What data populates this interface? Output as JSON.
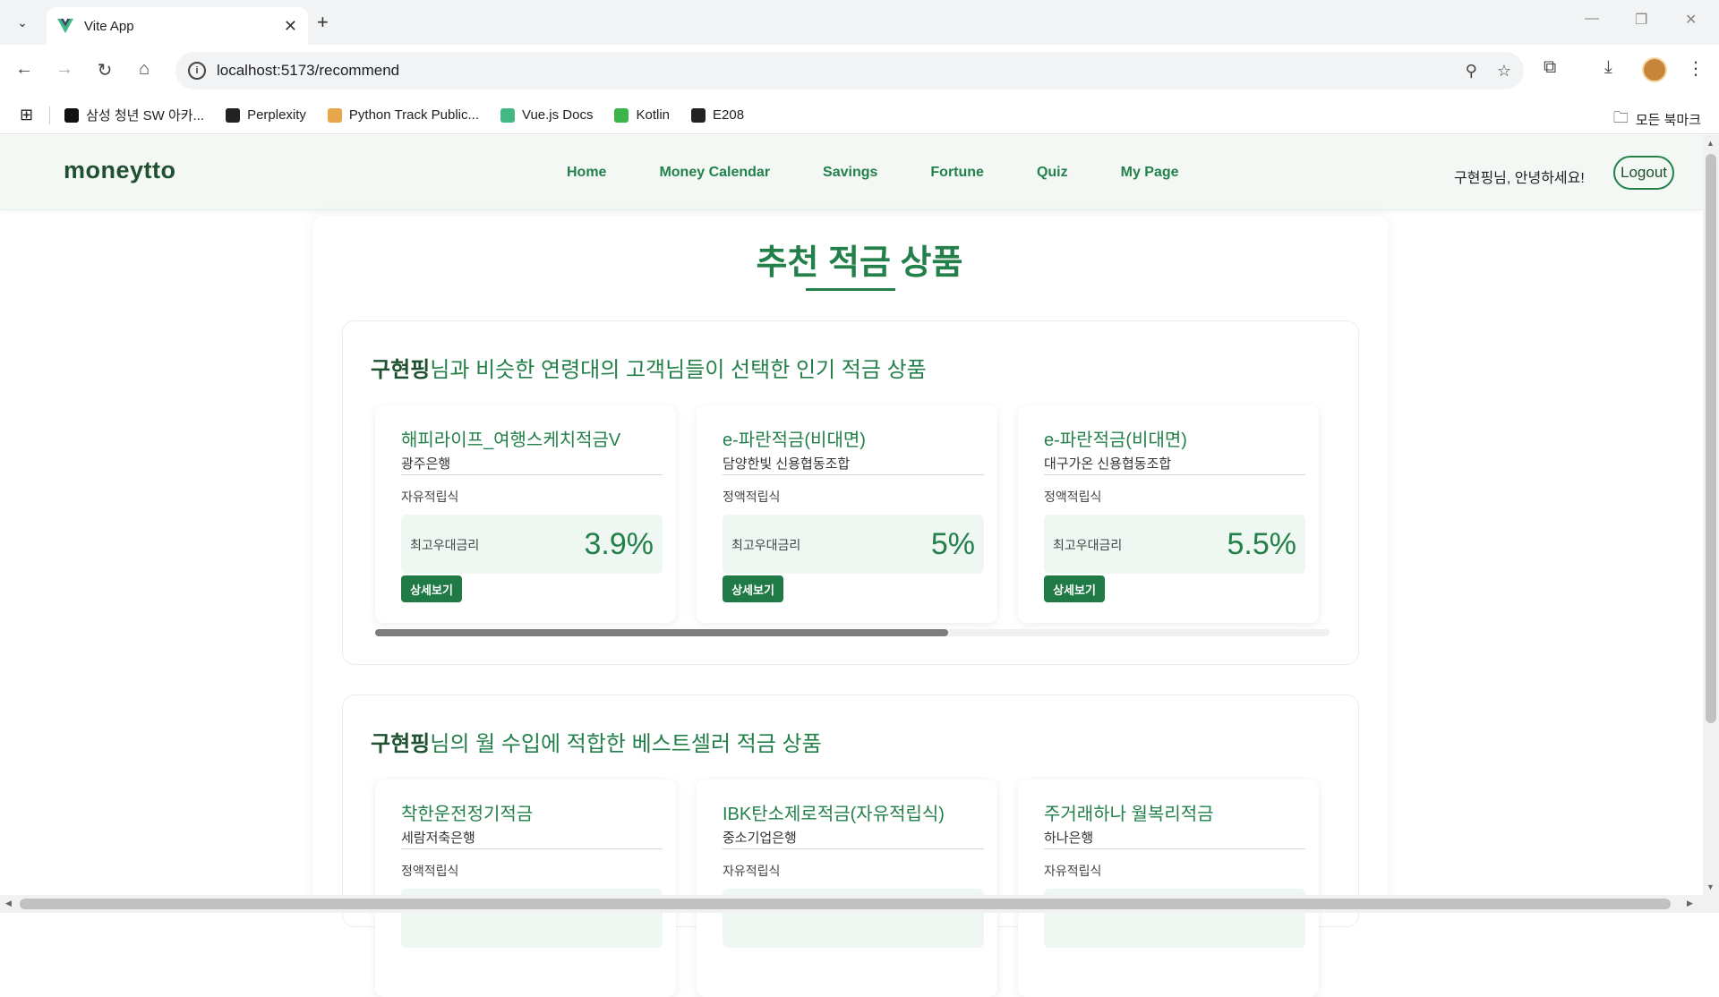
{
  "browser": {
    "tab_title": "Vite App",
    "url": "localhost:5173/recommend",
    "bookmarks": [
      {
        "label": "삼성 청년 SW 아카...",
        "color": "#111111"
      },
      {
        "label": "Perplexity",
        "color": "#222222"
      },
      {
        "label": "Python Track Public...",
        "color": "#e8a64a"
      },
      {
        "label": "Vue.js Docs",
        "color": "#42b883"
      },
      {
        "label": "Kotlin",
        "color": "#3bb54a"
      },
      {
        "label": "E208",
        "color": "#222222"
      }
    ],
    "all_bookmarks": "모든 북마크"
  },
  "app": {
    "logo": "moneytto",
    "nav": [
      "Home",
      "Money Calendar",
      "Savings",
      "Fortune",
      "Quiz",
      "My Page"
    ],
    "greeting": "구현핑님, 안녕하세요!",
    "logout": "Logout",
    "accent": "#24804a"
  },
  "page": {
    "title": "추천 적금 상품"
  },
  "sections": [
    {
      "user": "구현핑",
      "heading_rest": "님과 비슷한 연령대의 고객님들이 선택한 인기 적금 상품",
      "products": [
        {
          "name": "해피라이프_여행스케치적금V",
          "bank": "광주은행",
          "type": "자유적립식",
          "rate_label": "최고우대금리",
          "rate": "3.9%",
          "button": "상세보기"
        },
        {
          "name": "e-파란적금(비대면)",
          "bank": "담양한빛 신용협동조합",
          "type": "정액적립식",
          "rate_label": "최고우대금리",
          "rate": "5%",
          "button": "상세보기"
        },
        {
          "name": "e-파란적금(비대면)",
          "bank": "대구가온 신용협동조합",
          "type": "정액적립식",
          "rate_label": "최고우대금리",
          "rate": "5.5%",
          "button": "상세보기"
        }
      ]
    },
    {
      "user": "구현핑",
      "heading_rest": "님의 월 수입에 적합한 베스트셀러 적금 상품",
      "products": [
        {
          "name": "착한운전정기적금",
          "bank": "세람저축은행",
          "type": "정액적립식"
        },
        {
          "name": "IBK탄소제로적금(자유적립식)",
          "bank": "중소기업은행",
          "type": "자유적립식"
        },
        {
          "name": "주거래하나 월복리적금",
          "bank": "하나은행",
          "type": "자유적립식"
        }
      ]
    }
  ]
}
